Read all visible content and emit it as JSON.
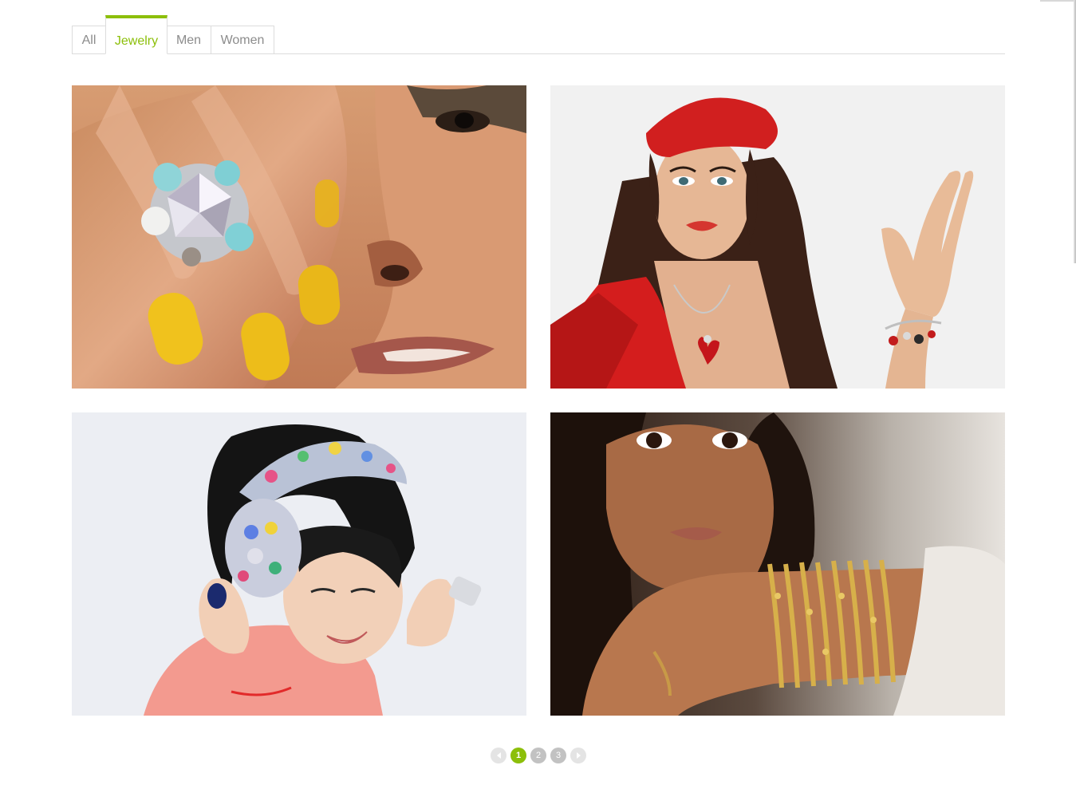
{
  "filters": {
    "tabs": [
      {
        "label": "All",
        "active": false
      },
      {
        "label": "Jewelry",
        "active": true
      },
      {
        "label": "Men",
        "active": false
      },
      {
        "label": "Women",
        "active": false
      }
    ]
  },
  "colors": {
    "accent": "#8cbf0a",
    "tab_text": "#8c8c8c",
    "border": "#dcdcdc",
    "pager_inactive": "#c2c2c2"
  },
  "gallery": {
    "items": [
      {
        "subject": "hand with jeweled ring and yellow nails over face"
      },
      {
        "subject": "woman in red beret with heart pendant and charm bracelet"
      },
      {
        "subject": "laughing woman wearing jeweled headphones and rings"
      },
      {
        "subject": "woman with stacked gold bangles on wrist"
      }
    ]
  },
  "pagination": {
    "current_page": 1,
    "pages": [
      "1",
      "2",
      "3"
    ],
    "prev_icon": "chevron-left-icon",
    "next_icon": "chevron-right-icon"
  }
}
